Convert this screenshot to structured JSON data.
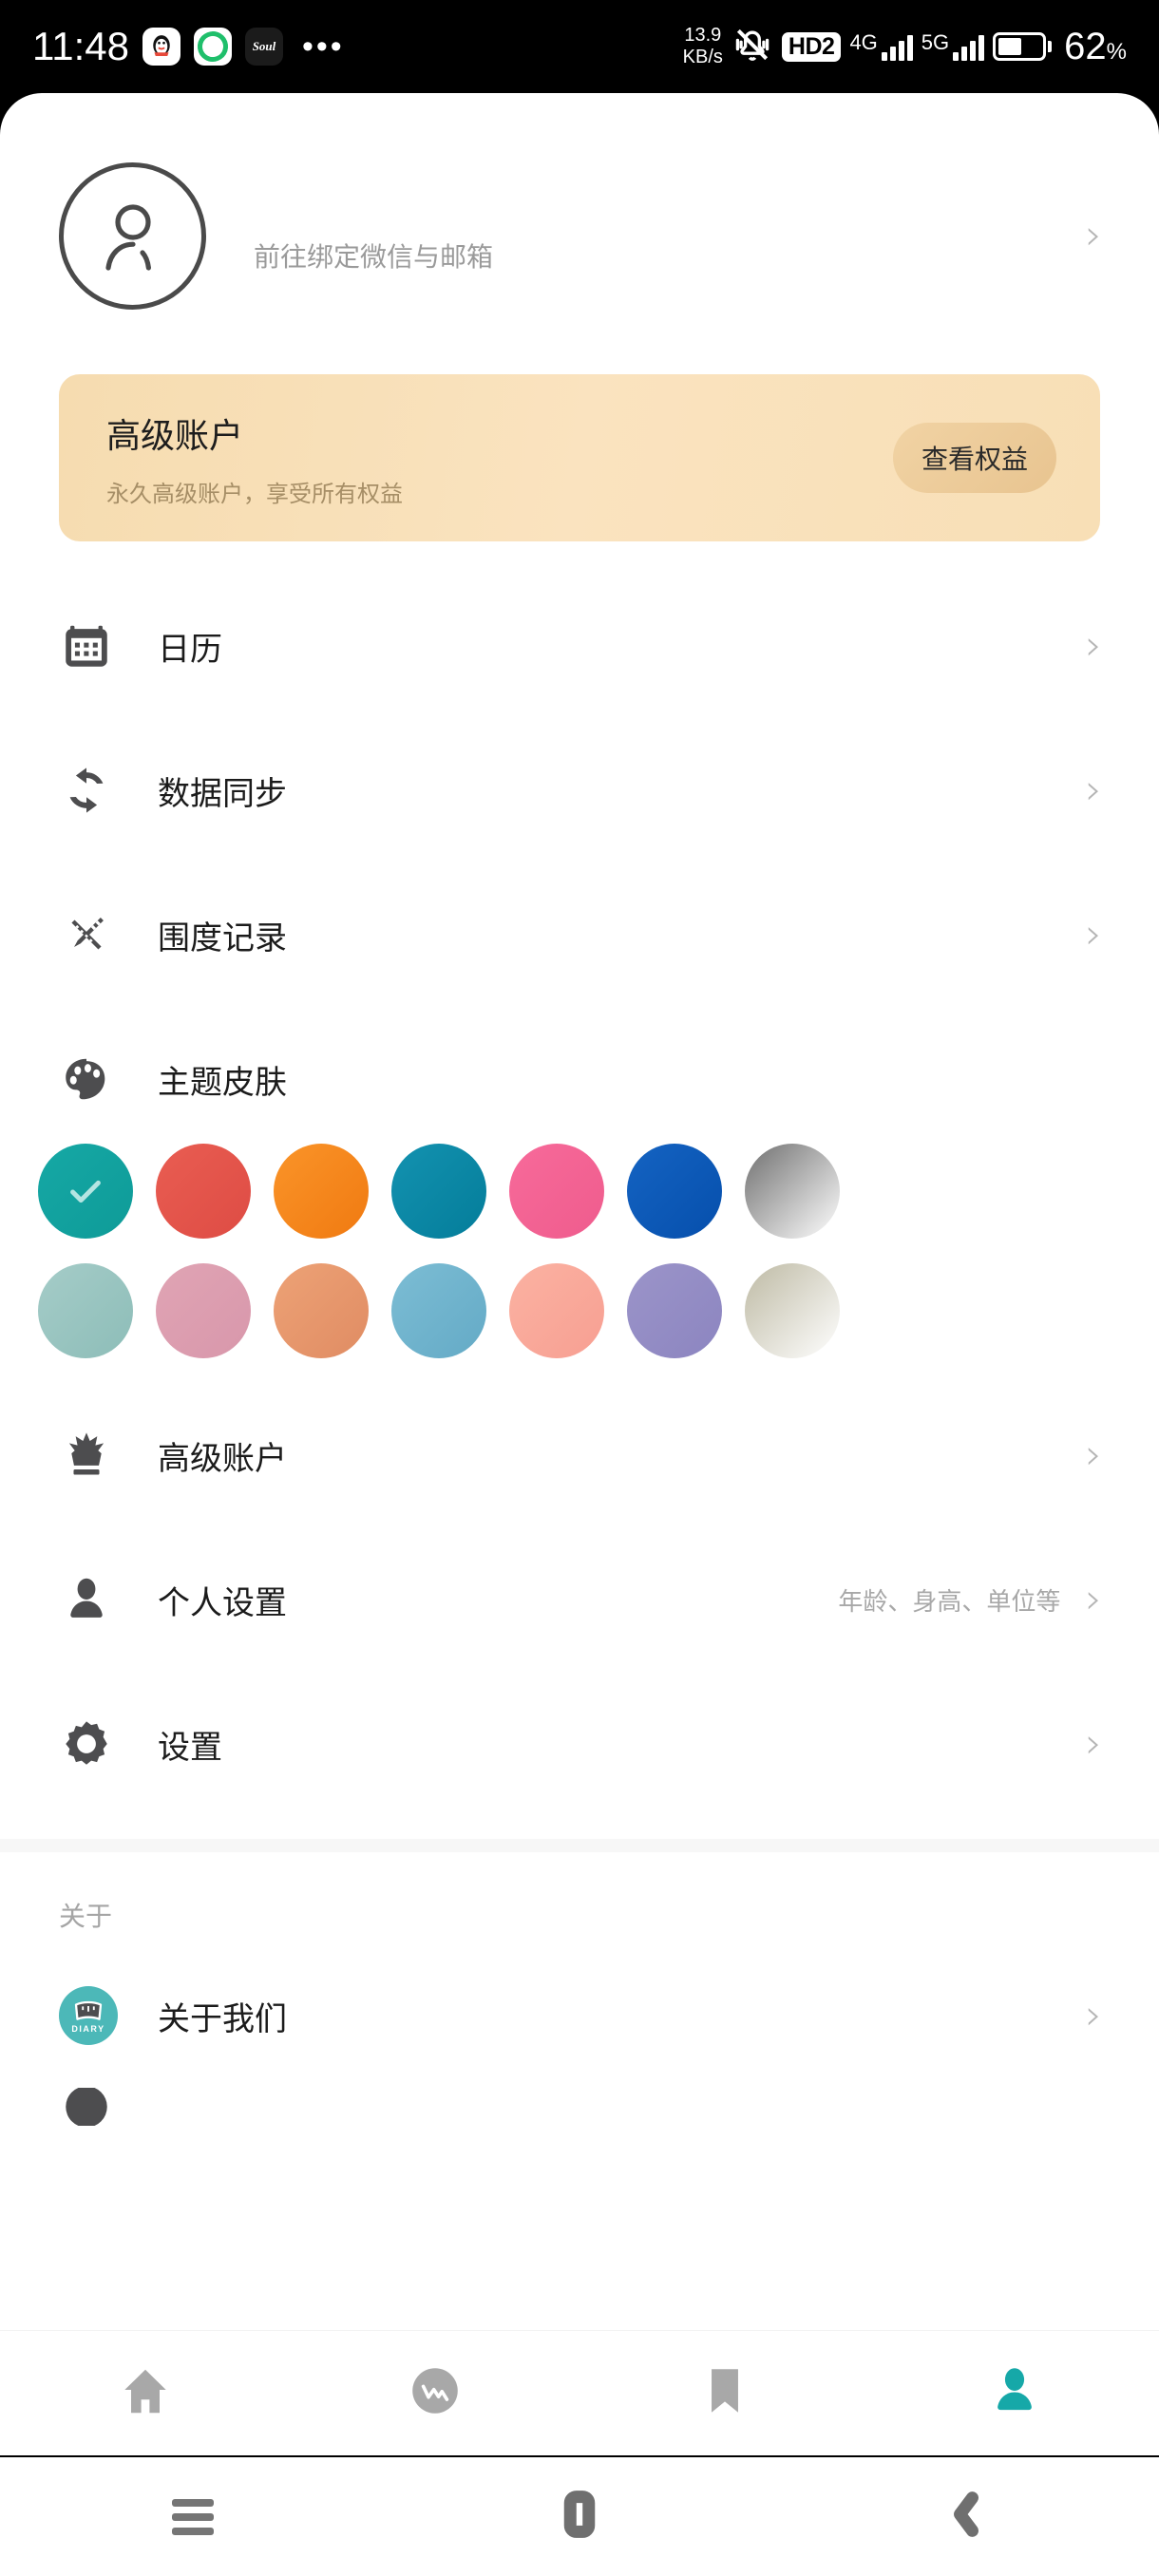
{
  "status_bar": {
    "time": "11:48",
    "app_icons": [
      "qq-icon",
      "green-refresh-icon",
      "soul-icon"
    ],
    "soul_label": "Soul",
    "overflow": "•••",
    "network_speed_value": "13.9",
    "network_speed_unit": "KB/s",
    "silent_icon": "bell-muted-icon",
    "hd_badge": "HD2",
    "sim1_label": "4G",
    "sim2_label": "5G",
    "battery_percent": "62",
    "battery_percent_symbol": "%"
  },
  "profile": {
    "avatar_icon": "person-outline-icon",
    "subtitle": "前往绑定微信与邮箱",
    "chevron": "›"
  },
  "banner": {
    "title": "高级账户",
    "subtitle": "永久高级账户，享受所有权益",
    "button_label": "查看权益",
    "bg_color": "#f6dcb0",
    "button_color": "#edcd9c"
  },
  "menu": {
    "items": [
      {
        "id": "calendar",
        "icon": "calendar-icon",
        "label": "日历",
        "hint": "",
        "chevron": "›"
      },
      {
        "id": "data-sync",
        "icon": "sync-icon",
        "label": "数据同步",
        "hint": "",
        "chevron": "›"
      },
      {
        "id": "measurements",
        "icon": "ruler-pencil-icon",
        "label": "围度记录",
        "hint": "",
        "chevron": "›"
      },
      {
        "id": "theme-skin",
        "icon": "palette-icon",
        "label": "主题皮肤",
        "hint": "",
        "chevron": ""
      }
    ],
    "items_lower": [
      {
        "id": "premium-account",
        "icon": "crown-icon",
        "label": "高级账户",
        "hint": "",
        "chevron": "›"
      },
      {
        "id": "personal-settings",
        "icon": "person-icon",
        "label": "个人设置",
        "hint": "年龄、身高、单位等",
        "chevron": "›"
      },
      {
        "id": "settings",
        "icon": "gear-icon",
        "label": "设置",
        "hint": "",
        "chevron": "›"
      }
    ]
  },
  "theme": {
    "selected_index": 0,
    "check_icon": "check-icon",
    "row1": [
      {
        "name": "teal",
        "from": "#16a8a5",
        "to": "#0e9b98",
        "selected": true
      },
      {
        "name": "red",
        "from": "#e95d52",
        "to": "#de4c44",
        "selected": false
      },
      {
        "name": "orange",
        "from": "#fa9429",
        "to": "#f07a11",
        "selected": false
      },
      {
        "name": "blue-teal",
        "from": "#1392b0",
        "to": "#047d9a",
        "selected": false
      },
      {
        "name": "pink",
        "from": "#f76a9a",
        "to": "#ef5c8d",
        "selected": false
      },
      {
        "name": "blue",
        "from": "#1463c2",
        "to": "#064fac",
        "selected": false
      },
      {
        "name": "gray-fade",
        "from": "#6f6f6f",
        "to": "#ffffff",
        "selected": false
      }
    ],
    "row2": [
      {
        "name": "soft-teal",
        "from": "#a5ccc8",
        "to": "#8dbdb8",
        "selected": false
      },
      {
        "name": "soft-pink",
        "from": "#e0a4b4",
        "to": "#d897ab",
        "selected": false
      },
      {
        "name": "soft-orange",
        "from": "#eda276",
        "to": "#e08c63",
        "selected": false
      },
      {
        "name": "soft-blue",
        "from": "#7cbdd4",
        "to": "#64aac6",
        "selected": false
      },
      {
        "name": "soft-coral",
        "from": "#fbb2a2",
        "to": "#f79f92",
        "selected": false
      },
      {
        "name": "soft-purple",
        "from": "#9b94c9",
        "to": "#8c85c0",
        "selected": false
      },
      {
        "name": "soft-beige",
        "from": "#bebaa4",
        "to": "#ffffff",
        "selected": false
      }
    ]
  },
  "about": {
    "section_title": "关于",
    "items": [
      {
        "id": "about-us",
        "icon": "diary-app-icon",
        "icon_text": "DIARY",
        "label": "关于我们",
        "chevron": "›"
      }
    ]
  },
  "tabbar": {
    "items": [
      {
        "id": "home",
        "icon": "home-icon",
        "active": false
      },
      {
        "id": "trend",
        "icon": "chart-circle-icon",
        "active": false
      },
      {
        "id": "bookmark",
        "icon": "bookmark-icon",
        "active": false
      },
      {
        "id": "profile",
        "icon": "person-icon",
        "active": true
      }
    ],
    "active_color": "#16a8a8",
    "inactive_color": "#a8a8a8"
  },
  "android_nav": {
    "items": [
      {
        "id": "recents",
        "icon": "menu-icon"
      },
      {
        "id": "home",
        "icon": "square-icon"
      },
      {
        "id": "back",
        "icon": "back-chevron-icon"
      }
    ]
  }
}
